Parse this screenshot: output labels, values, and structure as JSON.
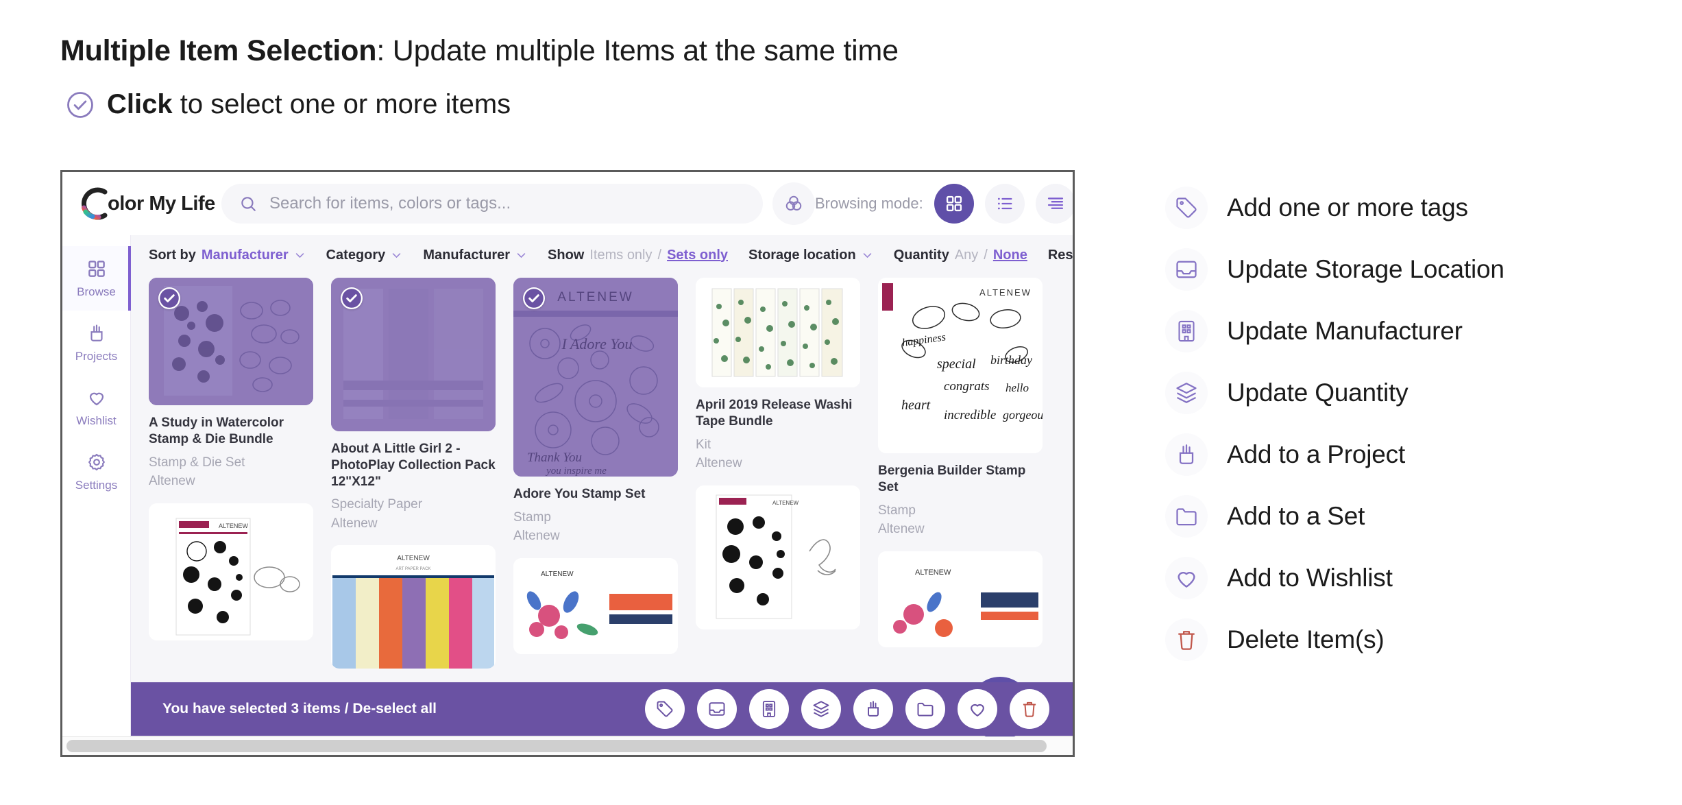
{
  "heading": {
    "bold": "Multiple Item Selection",
    "rest": ": Update multiple Items at the same time",
    "sub_bold": "Click",
    "sub_rest": " to select one or more items",
    "check_icon": "check-circle-icon"
  },
  "app": {
    "logo_text": "olor My Life",
    "logo_icon": "color-wheel-c-logo",
    "search": {
      "icon": "search-icon",
      "placeholder": "Search for items, colors or tags...",
      "value": ""
    },
    "color_filter_icon": "color-circles-icon",
    "browsing": {
      "label": "Browsing mode:",
      "modes": [
        {
          "icon": "grid-view-icon",
          "name": "grid",
          "active": true
        },
        {
          "icon": "list-view-icon",
          "name": "list",
          "active": false
        },
        {
          "icon": "detail-view-icon",
          "name": "detail",
          "active": false
        }
      ]
    },
    "sidebar": [
      {
        "label": "Browse",
        "icon": "grid-icon",
        "active": true
      },
      {
        "label": "Projects",
        "icon": "pencil-cup-icon",
        "active": false
      },
      {
        "label": "Wishlist",
        "icon": "heart-icon",
        "active": false
      },
      {
        "label": "Settings",
        "icon": "gear-icon",
        "active": false
      }
    ],
    "filters": {
      "sort_by_label": "Sort by",
      "sort_by_value": "Manufacturer",
      "category_label": "Category",
      "manufacturer_label": "Manufacturer",
      "show_label": "Show",
      "show_option_a": "Items only",
      "show_separator": "/",
      "show_option_b": "Sets only",
      "storage_label": "Storage location",
      "quantity_label": "Quantity",
      "quantity_option_a": "Any",
      "quantity_separator": "/",
      "quantity_option_b": "None",
      "reset_label": "Reset filters",
      "reset_icon": "refresh-icon",
      "chevron_icon": "chevron-down-icon"
    },
    "items": [
      {
        "title": "A Study in Watercolor Stamp & Die Bundle",
        "type": "Stamp & Die Set",
        "brand": "Altenew",
        "selected": true,
        "thumb": "watercolor-floral-stamp-die"
      },
      {
        "title": "About A Little Girl 2 - PhotoPlay Collection Pack 12\"X12\"",
        "type": "Specialty Paper",
        "brand": "Altenew",
        "selected": true,
        "thumb": "photoplay-paper-pack"
      },
      {
        "title": "Adore You Stamp Set",
        "type": "Stamp",
        "brand": "Altenew",
        "selected": true,
        "thumb": "adore-you-floral-stamp"
      },
      {
        "title": "April 2019 Release Washi Tape Bundle",
        "type": "Kit",
        "brand": "Altenew",
        "selected": false,
        "thumb": "washi-tape-bundle"
      },
      {
        "title": "Bergenia Builder Stamp Set",
        "type": "Stamp",
        "brand": "Altenew",
        "selected": false,
        "thumb": "bergenia-script-stamp"
      }
    ],
    "add_fab_icon": "plus-icon",
    "actionbar": {
      "status_text": "You have selected 3 items / De-select all",
      "buttons": [
        "tag-icon",
        "inbox-icon",
        "building-icon",
        "layers-icon",
        "pencil-cup-icon",
        "folder-icon",
        "heart-icon",
        "trash-icon"
      ]
    }
  },
  "legend": [
    {
      "icon": "tag-icon",
      "label": "Add one or more tags"
    },
    {
      "icon": "inbox-icon",
      "label": "Update Storage Location"
    },
    {
      "icon": "building-icon",
      "label": "Update Manufacturer"
    },
    {
      "icon": "layers-icon",
      "label": "Update Quantity"
    },
    {
      "icon": "pencil-cup-icon",
      "label": "Add to a Project"
    },
    {
      "icon": "folder-icon",
      "label": "Add to a Set"
    },
    {
      "icon": "heart-icon",
      "label": "Add to Wishlist"
    },
    {
      "icon": "trash-icon",
      "label": "Delete Item(s)"
    }
  ],
  "colors": {
    "purple": "#6a52a3",
    "accent": "#7e5fd0",
    "active_mode": "#5f4fa8",
    "selected_overlay": "#8f7ab9",
    "danger": "#c0564a",
    "muted_text": "#a6a6b3"
  }
}
